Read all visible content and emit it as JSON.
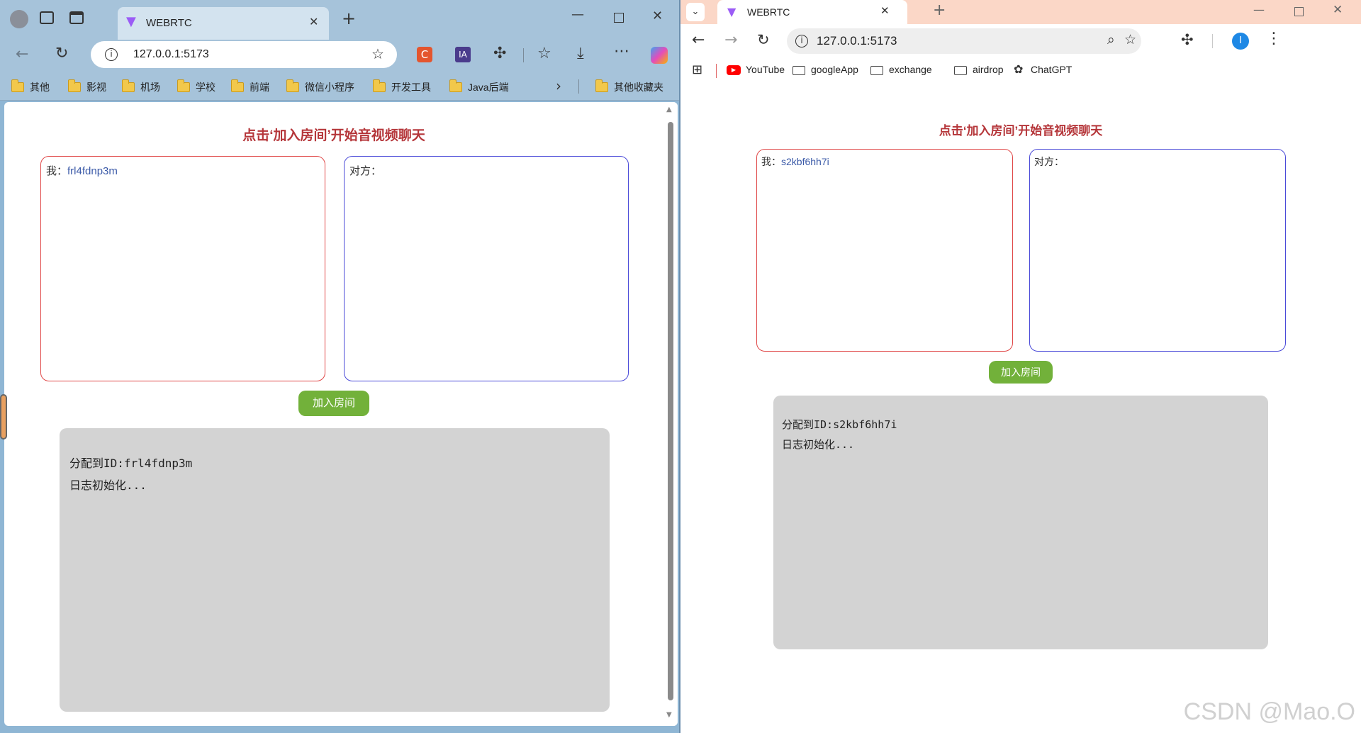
{
  "left_browser": {
    "tab_title": "WEBRTC",
    "url": "127.0.0.1:5173",
    "bookmarks": [
      "其他",
      "影视",
      "机场",
      "学校",
      "前端",
      "微信小程序",
      "开发工具",
      "Java后端"
    ],
    "other_bookmarks": "其他收藏夹",
    "page": {
      "title": "点击‘加入房间’开始音视频聊天",
      "me_label": "我：",
      "me_id": "frl4fdnp3m",
      "peer_label": "对方：",
      "join_button": "加入房间",
      "log_lines": [
        "分配到ID:frl4fdnp3m",
        "日志初始化..."
      ]
    }
  },
  "right_browser": {
    "tab_title": "WEBRTC",
    "url": "127.0.0.1:5173",
    "bookmarks": [
      "YouTube",
      "googleApp",
      "exchange",
      "airdrop",
      "ChatGPT"
    ],
    "profile_initial": "I",
    "page": {
      "title": "点击‘加入房间’开始音视频聊天",
      "me_label": "我：",
      "me_id": "s2kbf6hh7i",
      "peer_label": "对方：",
      "join_button": "加入房间",
      "log_lines": [
        "分配到ID:s2kbf6hh7i",
        "日志初始化..."
      ]
    }
  },
  "watermark": "CSDN @Mao.O",
  "colors": {
    "title_red": "#b5363a",
    "me_border": "#e04848",
    "peer_border": "#4a4ad8",
    "button_green": "#72b13a",
    "log_gray": "#d3d3d3"
  },
  "icons": [
    "profile-icon",
    "workspaces-icon",
    "tab-actions-icon",
    "vite-logo-icon",
    "close-icon",
    "plus-icon",
    "minimize-icon",
    "maximize-icon",
    "back-icon",
    "forward-icon",
    "reload-icon",
    "info-icon",
    "star-icon",
    "extension-icon",
    "favorites-icon",
    "download-icon",
    "more-icon",
    "copilot-icon",
    "folder-icon",
    "apps-grid-icon",
    "zoom-icon",
    "youtube-icon",
    "chatgpt-icon"
  ]
}
